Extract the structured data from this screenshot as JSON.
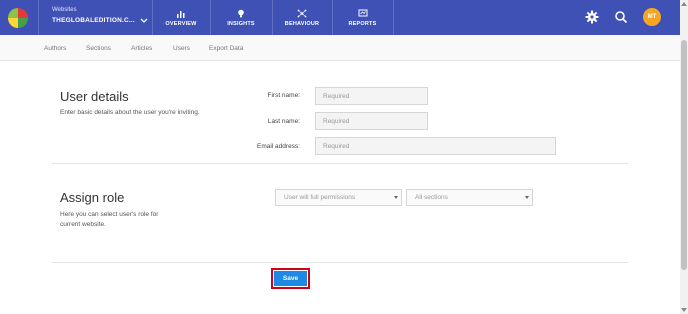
{
  "topbar": {
    "site_label": "Websites",
    "site_name": "THEGLOBALEDITION.C...",
    "nav": [
      {
        "label": "OVERVIEW",
        "icon": "bar-chart-icon"
      },
      {
        "label": "INSIGHTS",
        "icon": "lightbulb-icon"
      },
      {
        "label": "BEHAVIOUR",
        "icon": "network-icon"
      },
      {
        "label": "REPORTS",
        "icon": "report-icon"
      }
    ],
    "avatar_initials": "MT",
    "brand_color": "#3f51b5",
    "avatar_color": "#f5a623"
  },
  "subnav": {
    "tabs": [
      "Authors",
      "Sections",
      "Articles",
      "Users",
      "Export Data"
    ]
  },
  "user_details": {
    "title": "User details",
    "description": "Enter basic details about the user you're inviting.",
    "first_name_label": "First name:",
    "first_name_placeholder": "Required",
    "last_name_label": "Last name:",
    "last_name_placeholder": "Required",
    "email_label": "Email address:",
    "email_placeholder": "Required"
  },
  "assign_role": {
    "title": "Assign role",
    "description_line1": "Here you can select user's role for",
    "description_line2": "current website.",
    "permission_value": "User will full permissions",
    "sections_value": "All sections"
  },
  "actions": {
    "save_label": "Save",
    "save_color": "#1e88e5",
    "highlight_color": "#d0021b"
  }
}
